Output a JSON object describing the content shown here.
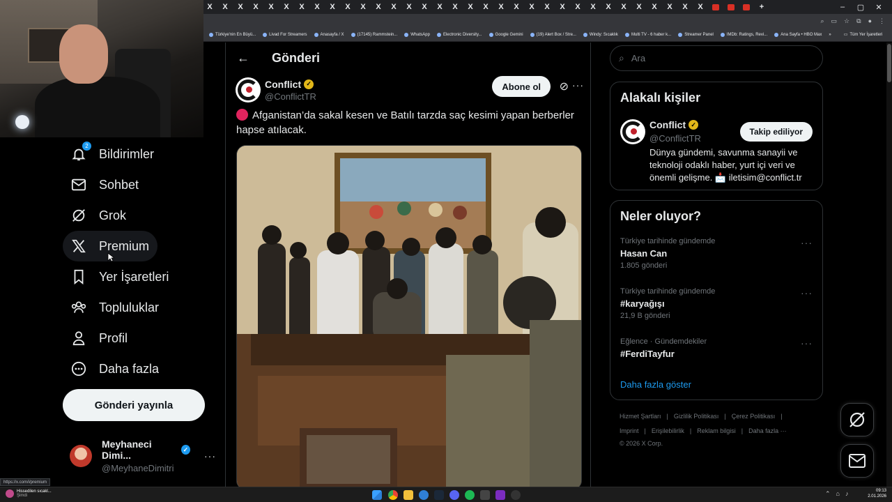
{
  "browser": {
    "tab_glyph": "X",
    "bookmarks": [
      "Türkiye'nin En Büyü...",
      "Livad For Streamers",
      "Anasayfa / X",
      "(17145) Rammstein...",
      "WhatsApp",
      "Electronic Diversity...",
      "Google Gemini",
      "(19) Alert Box / Stre...",
      "Windy: Sıcaklık",
      "Multi TV - 6 haber k...",
      "Streamer Panel",
      "IMDb: Ratings, Revi...",
      "Ana Sayfa • HBO Max"
    ],
    "bookmarks_more": "»",
    "all_bookmarks": "Tüm Yer İşaretleri",
    "status_url": "https://x.com/i/premium"
  },
  "sidebar": {
    "items": [
      {
        "label": "Bildirimler",
        "icon": "bell-icon",
        "badge": "2"
      },
      {
        "label": "Sohbet",
        "icon": "envelope-icon"
      },
      {
        "label": "Grok",
        "icon": "grok-icon"
      },
      {
        "label": "Premium",
        "icon": "x-logo-icon"
      },
      {
        "label": "Yer İşaretleri",
        "icon": "bookmark-icon"
      },
      {
        "label": "Topluluklar",
        "icon": "communities-icon"
      },
      {
        "label": "Profil",
        "icon": "person-icon"
      },
      {
        "label": "Daha fazla",
        "icon": "more-circle-icon"
      }
    ],
    "post_button": "Gönderi yayınla",
    "account": {
      "name": "Meyhaneci Dimi...",
      "handle": "@MeyhaneDimitri",
      "more": "···"
    }
  },
  "main": {
    "back": "←",
    "title": "Gönderi",
    "post": {
      "author_name": "Conflict",
      "author_handle": "@ConflictTR",
      "subscribe": "Abone ol",
      "more": "···",
      "text": "Afganistan’da sakal kesen ve Batılı tarzda saç kesimi yapan berberler hapse atılacak."
    }
  },
  "right": {
    "search_placeholder": "Ara",
    "related": {
      "title": "Alakalı kişiler",
      "name": "Conflict",
      "handle": "@ConflictTR",
      "follow_button": "Takip ediliyor",
      "bio": "Dünya gündemi, savunma sanayii ve teknoloji odaklı haber, yurt içi veri ve önemli gelişme. 📩 iletisim@conflict.tr"
    },
    "trends": {
      "title": "Neler oluyor?",
      "items": [
        {
          "meta": "Türkiye tarihinde gündemde",
          "name": "Hasan Can",
          "count": "1.805 gönderi"
        },
        {
          "meta": "Türkiye tarihinde gündemde",
          "name": "#karyağışı",
          "count": "21,9 B gönderi"
        },
        {
          "meta": "Eğlence · Gündemdekiler",
          "name": "#FerdiTayfur",
          "count": ""
        }
      ],
      "show_more": "Daha fazla göster",
      "dots": "···"
    },
    "footer": {
      "row1": [
        "Hizmet Şartları",
        "|",
        "Gizlilik Politikası",
        "|",
        "Çerez Politikası",
        "|"
      ],
      "row2": [
        "Imprint",
        "|",
        "Erişilebilirlik",
        "|",
        "Reklam bilgisi",
        "|",
        "Daha fazla ···"
      ],
      "copyright": "© 2026 X Corp."
    }
  },
  "taskbar": {
    "notification_title": "Hissedilen sıcakl...",
    "notification_sub": "Şimdi",
    "time": "09:13",
    "date": "2.01.2026"
  },
  "colors": {
    "accent": "#1d9bf0",
    "gold_badge": "#e2b719",
    "background": "#000000",
    "border": "#2f3336"
  }
}
